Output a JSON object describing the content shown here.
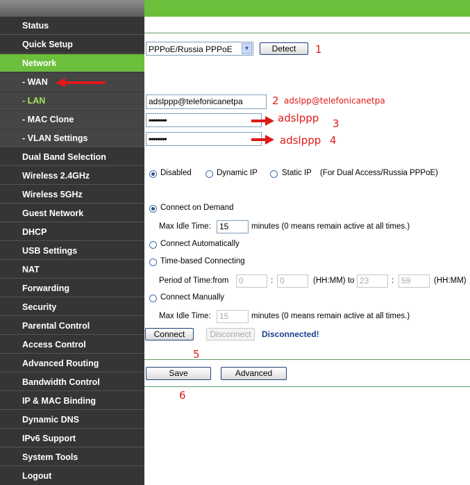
{
  "sidebar": {
    "items": [
      {
        "label": "Status"
      },
      {
        "label": "Quick Setup"
      },
      {
        "label": "Network"
      },
      {
        "label": "- WAN"
      },
      {
        "label": "- LAN"
      },
      {
        "label": "- MAC Clone"
      },
      {
        "label": "- VLAN Settings"
      },
      {
        "label": "Dual Band Selection"
      },
      {
        "label": "Wireless 2.4GHz"
      },
      {
        "label": "Wireless 5GHz"
      },
      {
        "label": "Guest Network"
      },
      {
        "label": "DHCP"
      },
      {
        "label": "USB Settings"
      },
      {
        "label": "NAT"
      },
      {
        "label": "Forwarding"
      },
      {
        "label": "Security"
      },
      {
        "label": "Parental Control"
      },
      {
        "label": "Access Control"
      },
      {
        "label": "Advanced Routing"
      },
      {
        "label": "Bandwidth Control"
      },
      {
        "label": "IP & MAC Binding"
      },
      {
        "label": "Dynamic DNS"
      },
      {
        "label": "IPv6 Support"
      },
      {
        "label": "System Tools"
      },
      {
        "label": "Logout"
      }
    ]
  },
  "wan": {
    "connection_type": "PPPoE/Russia PPPoE",
    "detect_label": "Detect",
    "username": "adslppp@telefonicanetpa",
    "password": "••••••••",
    "confirm_password": "••••••••",
    "secondary": {
      "disabled": "Disabled",
      "dynamic_ip": "Dynamic IP",
      "static_ip": "Static IP",
      "note": "(For Dual Access/Russia PPPoE)"
    },
    "modes": {
      "on_demand": "Connect on Demand",
      "max_idle_label": "Max Idle Time:",
      "max_idle_value_1": "15",
      "max_idle_note": "minutes (0 means remain active at all times.)",
      "automatic": "Connect Automatically",
      "time_based": "Time-based Connecting",
      "period_label": "Period of Time:from",
      "from_h": "0",
      "from_m": "0",
      "hhmm_to": "(HH:MM) to",
      "to_h": "23",
      "to_m": "59",
      "hhmm": "(HH:MM)",
      "colon": ":",
      "manual": "Connect Manually",
      "max_idle_value_2": "15"
    },
    "connect_label": "Connect",
    "disconnect_label": "Disconnect",
    "status": "Disconnected!",
    "save_label": "Save",
    "advanced_label": "Advanced"
  },
  "annotations": {
    "n1": "1",
    "n2": "2",
    "n2_text": "adslpp@telefonicanetpa",
    "n3_text": "adslppp",
    "n3": "3",
    "n4_text": "adslppp",
    "n4": "4",
    "n5": "5",
    "n6": "6"
  },
  "colors": {
    "accent_green": "#6bbf3b",
    "sidebar_bg": "#323232",
    "annotation_red": "#e01818",
    "status_blue": "#1a3f8f"
  }
}
